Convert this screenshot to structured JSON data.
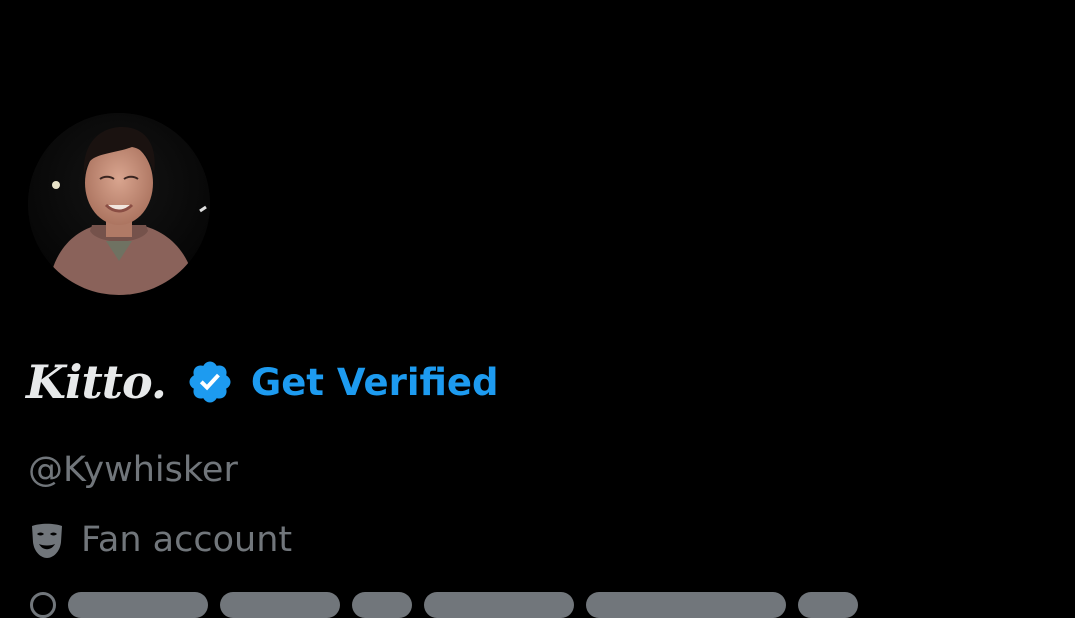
{
  "profile": {
    "display_name": "Kitto.",
    "get_verified_label": "Get Verified",
    "handle": "@Kywhisker",
    "label_icon": "theater-mask-icon",
    "label_text": "Fan account",
    "verified_badge_icon": "verified-badge-icon"
  },
  "colors": {
    "background": "#000000",
    "primary_text": "#e7e9ea",
    "secondary_text": "#71767b",
    "accent": "#1d9bf0"
  }
}
